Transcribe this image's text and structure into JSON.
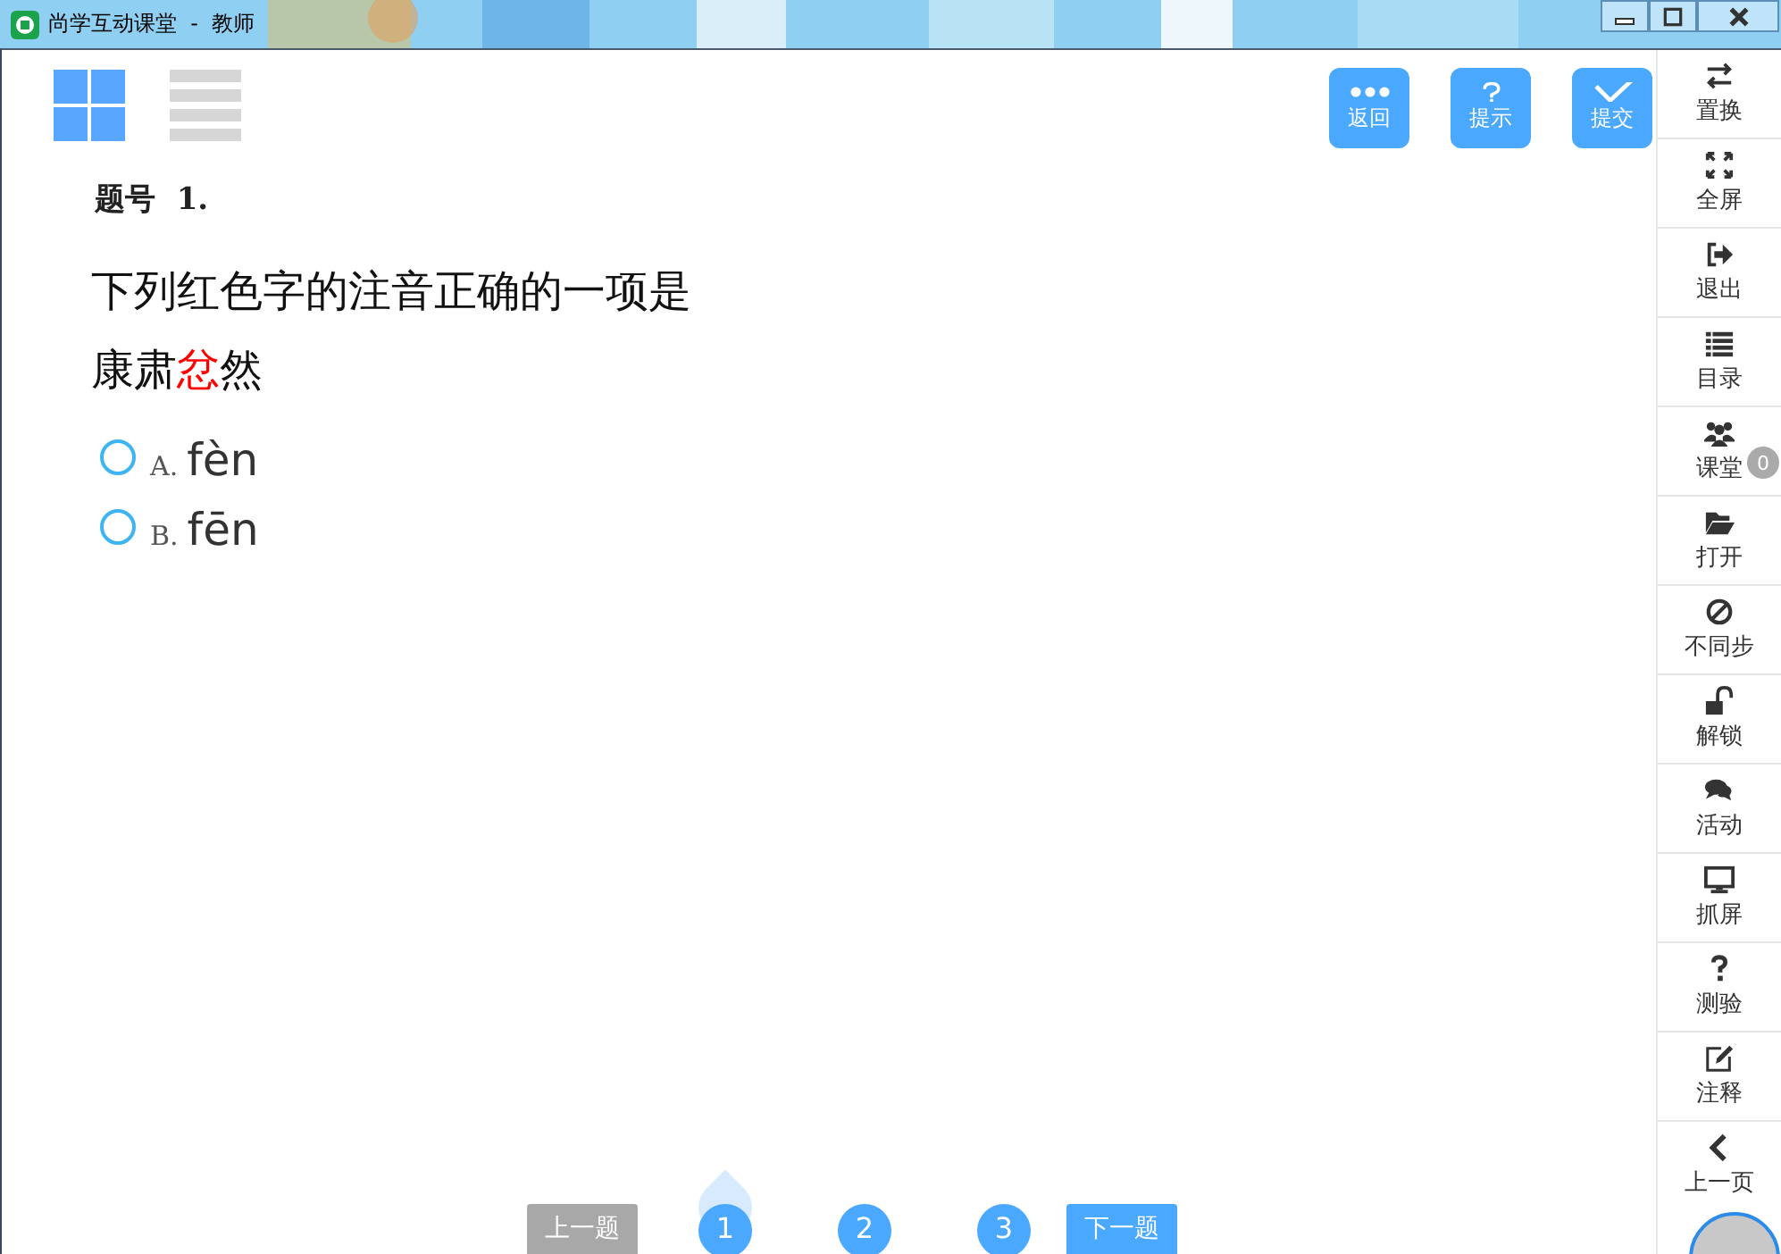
{
  "window": {
    "title": "尚学互动课堂  -  教师"
  },
  "view_toggle": [
    {
      "kind": "grid",
      "selected": true
    },
    {
      "kind": "list",
      "selected": false
    }
  ],
  "actions": [
    {
      "kind": "more",
      "label": "返回"
    },
    {
      "kind": "hint",
      "label": "提示"
    },
    {
      "kind": "submit",
      "label": "提交"
    }
  ],
  "question": {
    "number_label": "题号",
    "number": "1.",
    "prompt": "下列红色字的注音正确的一项是",
    "stem": [
      {
        "text": "康肃",
        "highlight": false
      },
      {
        "text": "忿",
        "highlight": true
      },
      {
        "text": "然",
        "highlight": false
      }
    ]
  },
  "options": [
    {
      "letter": "A.",
      "text": "fèn",
      "selected": false
    },
    {
      "letter": "B.",
      "text": "fēn",
      "selected": false
    }
  ],
  "pager": {
    "prev": {
      "label": "上一题",
      "disabled": true
    },
    "pages": [
      {
        "label": "1",
        "selected": true
      },
      {
        "label": "2",
        "selected": false
      },
      {
        "label": "3",
        "selected": false
      }
    ],
    "next": {
      "label": "下一题",
      "disabled": false
    }
  },
  "sidebar": [
    {
      "kind": "swap",
      "label": "置换"
    },
    {
      "kind": "fullscreen",
      "label": "全屏"
    },
    {
      "kind": "exit",
      "label": "退出"
    },
    {
      "kind": "list",
      "label": "目录"
    },
    {
      "kind": "users",
      "label": "课堂",
      "badge": "0"
    },
    {
      "kind": "folder",
      "label": "打开"
    },
    {
      "kind": "ban",
      "label": "不同步"
    },
    {
      "kind": "unlock",
      "label": "解锁"
    },
    {
      "kind": "chat",
      "label": "活动"
    },
    {
      "kind": "monitor",
      "label": "抓屏"
    },
    {
      "kind": "question",
      "label": "测验"
    },
    {
      "kind": "edit",
      "label": "注释"
    },
    {
      "kind": "back",
      "label": "上一页"
    }
  ]
}
